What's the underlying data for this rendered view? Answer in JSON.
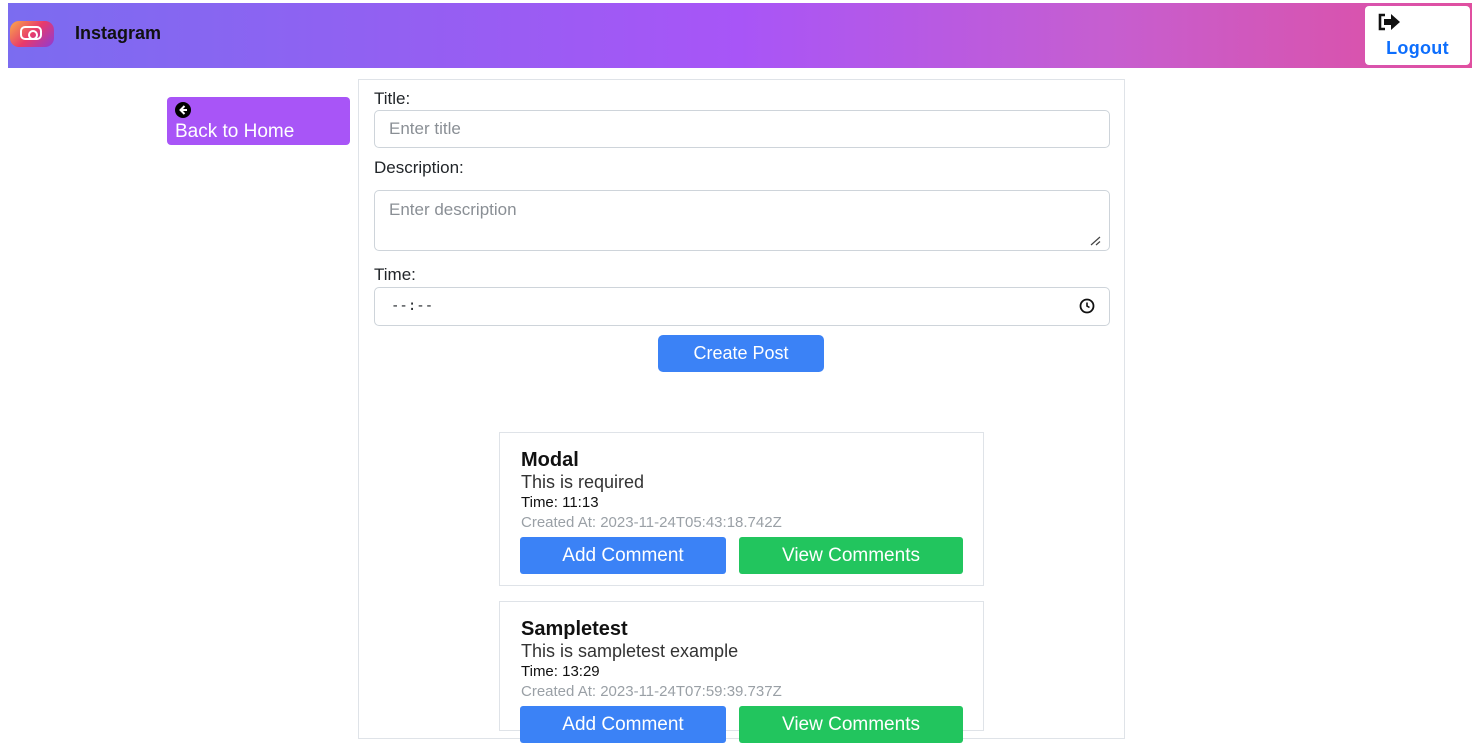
{
  "navbar": {
    "brand": "Instagram",
    "logout_label": "Logout",
    "colors": {
      "gradient_start": "#7b6cf0",
      "gradient_end": "#e04fa0"
    }
  },
  "back_button": {
    "label": "Back to Home",
    "icon": "arrow-left-circle-icon",
    "color": "#a855f7"
  },
  "form": {
    "title_label": "Title:",
    "title_placeholder": "Enter title",
    "title_value": "",
    "description_label": "Description:",
    "description_placeholder": "Enter description",
    "description_value": "",
    "time_label": "Time:",
    "time_value": "--:--",
    "submit_label": "Create Post"
  },
  "posts": [
    {
      "title": "Modal",
      "description": "This is required",
      "time": "Time: 11:13",
      "created_at": "Created At: 2023-11-24T05:43:18.742Z",
      "add_comment_label": "Add Comment",
      "view_comments_label": "View Comments"
    },
    {
      "title": "Sampletest",
      "description": "This is sampletest example",
      "time": "Time: 13:29",
      "created_at": "Created At: 2023-11-24T07:59:39.737Z",
      "add_comment_label": "Add Comment",
      "view_comments_label": "View Comments"
    }
  ],
  "colors": {
    "primary": "#3b82f6",
    "success": "#22c55e",
    "accent": "#a855f7"
  }
}
